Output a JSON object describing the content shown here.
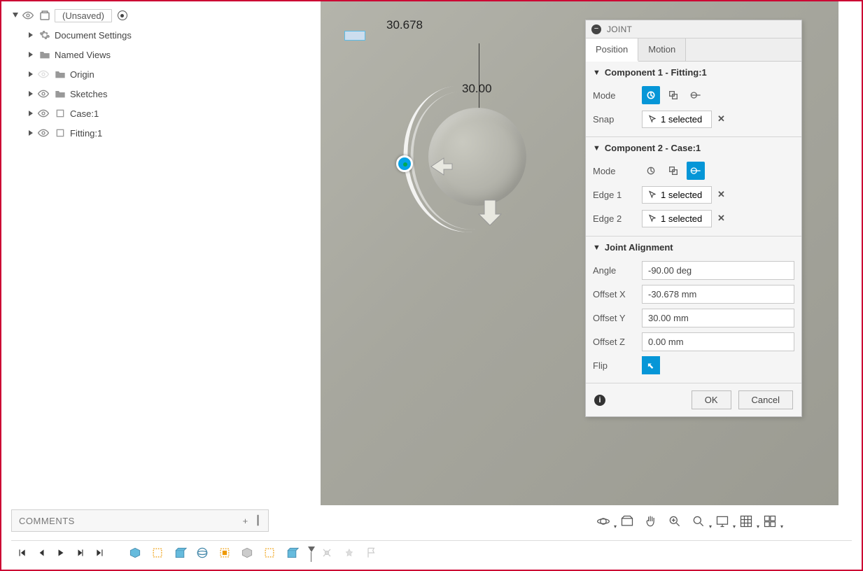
{
  "browser": {
    "root": "(Unsaved)",
    "items": [
      {
        "label": "Document Settings",
        "icon": "gear",
        "visible": true
      },
      {
        "label": "Named Views",
        "icon": "folder",
        "visible": true
      },
      {
        "label": "Origin",
        "icon": "folder",
        "visible": false
      },
      {
        "label": "Sketches",
        "icon": "folder",
        "visible": true
      },
      {
        "label": "Case:1",
        "icon": "component",
        "visible": true
      },
      {
        "label": "Fitting:1",
        "icon": "component",
        "visible": true
      }
    ]
  },
  "viewport": {
    "dim_x": "30.678",
    "dim_y": "30.00"
  },
  "panel": {
    "title": "JOINT",
    "tabs": {
      "position": "Position",
      "motion": "Motion",
      "active": "position"
    },
    "comp1": {
      "title": "Component 1 - Fitting:1",
      "mode_label": "Mode",
      "snap_label": "Snap",
      "snap_value": "1 selected"
    },
    "comp2": {
      "title": "Component 2 - Case:1",
      "mode_label": "Mode",
      "edge1_label": "Edge 1",
      "edge1_value": "1 selected",
      "edge2_label": "Edge 2",
      "edge2_value": "1 selected"
    },
    "align": {
      "title": "Joint Alignment",
      "angle_label": "Angle",
      "angle_value": "-90.00 deg",
      "ox_label": "Offset X",
      "ox_value": "-30.678 mm",
      "oy_label": "Offset Y",
      "oy_value": "30.00 mm",
      "oz_label": "Offset Z",
      "oz_value": "0.00 mm",
      "flip_label": "Flip"
    },
    "ok": "OK",
    "cancel": "Cancel"
  },
  "comments": {
    "title": "COMMENTS"
  }
}
